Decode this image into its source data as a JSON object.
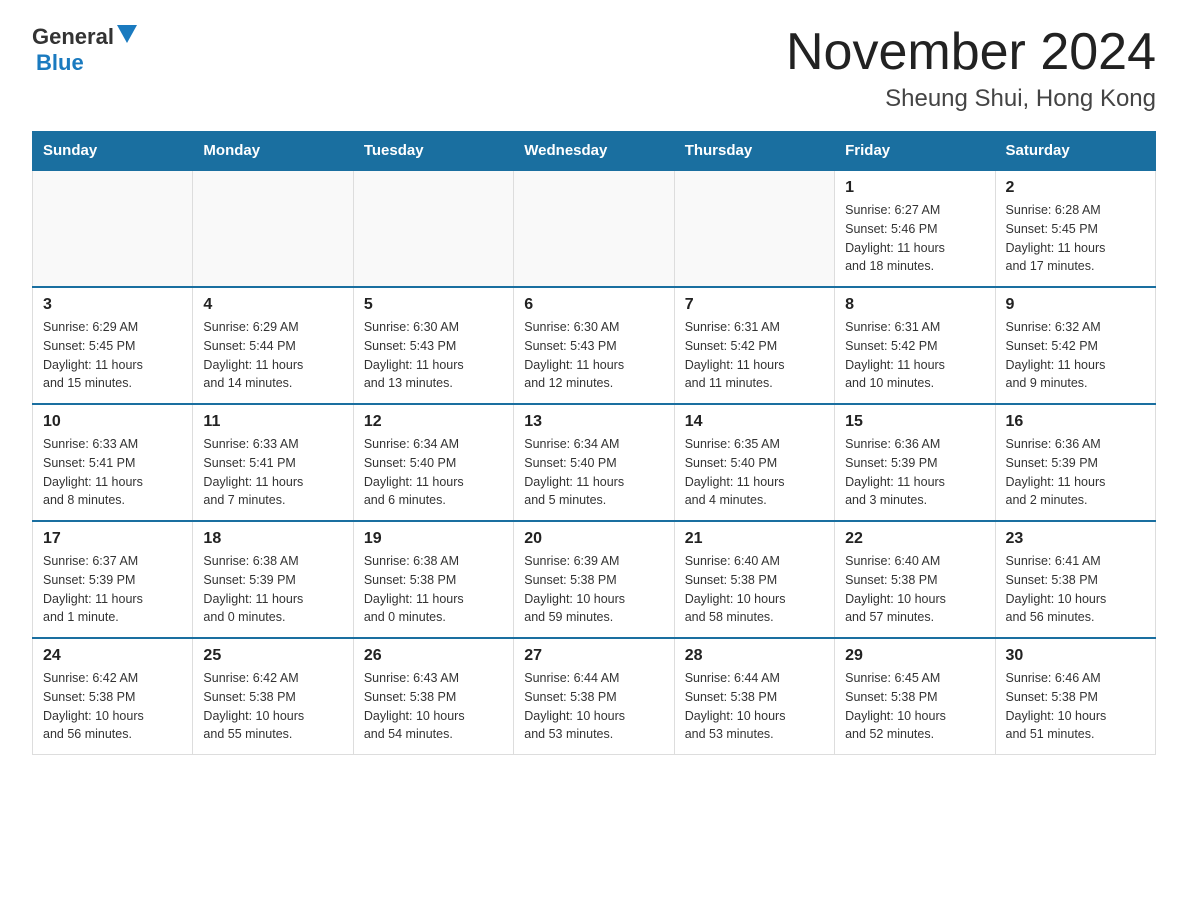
{
  "logo": {
    "general": "General",
    "triangle": "▲",
    "blue": "Blue"
  },
  "title": "November 2024",
  "subtitle": "Sheung Shui, Hong Kong",
  "days_header": [
    "Sunday",
    "Monday",
    "Tuesday",
    "Wednesday",
    "Thursday",
    "Friday",
    "Saturday"
  ],
  "weeks": [
    [
      {
        "day": "",
        "info": ""
      },
      {
        "day": "",
        "info": ""
      },
      {
        "day": "",
        "info": ""
      },
      {
        "day": "",
        "info": ""
      },
      {
        "day": "",
        "info": ""
      },
      {
        "day": "1",
        "info": "Sunrise: 6:27 AM\nSunset: 5:46 PM\nDaylight: 11 hours\nand 18 minutes."
      },
      {
        "day": "2",
        "info": "Sunrise: 6:28 AM\nSunset: 5:45 PM\nDaylight: 11 hours\nand 17 minutes."
      }
    ],
    [
      {
        "day": "3",
        "info": "Sunrise: 6:29 AM\nSunset: 5:45 PM\nDaylight: 11 hours\nand 15 minutes."
      },
      {
        "day": "4",
        "info": "Sunrise: 6:29 AM\nSunset: 5:44 PM\nDaylight: 11 hours\nand 14 minutes."
      },
      {
        "day": "5",
        "info": "Sunrise: 6:30 AM\nSunset: 5:43 PM\nDaylight: 11 hours\nand 13 minutes."
      },
      {
        "day": "6",
        "info": "Sunrise: 6:30 AM\nSunset: 5:43 PM\nDaylight: 11 hours\nand 12 minutes."
      },
      {
        "day": "7",
        "info": "Sunrise: 6:31 AM\nSunset: 5:42 PM\nDaylight: 11 hours\nand 11 minutes."
      },
      {
        "day": "8",
        "info": "Sunrise: 6:31 AM\nSunset: 5:42 PM\nDaylight: 11 hours\nand 10 minutes."
      },
      {
        "day": "9",
        "info": "Sunrise: 6:32 AM\nSunset: 5:42 PM\nDaylight: 11 hours\nand 9 minutes."
      }
    ],
    [
      {
        "day": "10",
        "info": "Sunrise: 6:33 AM\nSunset: 5:41 PM\nDaylight: 11 hours\nand 8 minutes."
      },
      {
        "day": "11",
        "info": "Sunrise: 6:33 AM\nSunset: 5:41 PM\nDaylight: 11 hours\nand 7 minutes."
      },
      {
        "day": "12",
        "info": "Sunrise: 6:34 AM\nSunset: 5:40 PM\nDaylight: 11 hours\nand 6 minutes."
      },
      {
        "day": "13",
        "info": "Sunrise: 6:34 AM\nSunset: 5:40 PM\nDaylight: 11 hours\nand 5 minutes."
      },
      {
        "day": "14",
        "info": "Sunrise: 6:35 AM\nSunset: 5:40 PM\nDaylight: 11 hours\nand 4 minutes."
      },
      {
        "day": "15",
        "info": "Sunrise: 6:36 AM\nSunset: 5:39 PM\nDaylight: 11 hours\nand 3 minutes."
      },
      {
        "day": "16",
        "info": "Sunrise: 6:36 AM\nSunset: 5:39 PM\nDaylight: 11 hours\nand 2 minutes."
      }
    ],
    [
      {
        "day": "17",
        "info": "Sunrise: 6:37 AM\nSunset: 5:39 PM\nDaylight: 11 hours\nand 1 minute."
      },
      {
        "day": "18",
        "info": "Sunrise: 6:38 AM\nSunset: 5:39 PM\nDaylight: 11 hours\nand 0 minutes."
      },
      {
        "day": "19",
        "info": "Sunrise: 6:38 AM\nSunset: 5:38 PM\nDaylight: 11 hours\nand 0 minutes."
      },
      {
        "day": "20",
        "info": "Sunrise: 6:39 AM\nSunset: 5:38 PM\nDaylight: 10 hours\nand 59 minutes."
      },
      {
        "day": "21",
        "info": "Sunrise: 6:40 AM\nSunset: 5:38 PM\nDaylight: 10 hours\nand 58 minutes."
      },
      {
        "day": "22",
        "info": "Sunrise: 6:40 AM\nSunset: 5:38 PM\nDaylight: 10 hours\nand 57 minutes."
      },
      {
        "day": "23",
        "info": "Sunrise: 6:41 AM\nSunset: 5:38 PM\nDaylight: 10 hours\nand 56 minutes."
      }
    ],
    [
      {
        "day": "24",
        "info": "Sunrise: 6:42 AM\nSunset: 5:38 PM\nDaylight: 10 hours\nand 56 minutes."
      },
      {
        "day": "25",
        "info": "Sunrise: 6:42 AM\nSunset: 5:38 PM\nDaylight: 10 hours\nand 55 minutes."
      },
      {
        "day": "26",
        "info": "Sunrise: 6:43 AM\nSunset: 5:38 PM\nDaylight: 10 hours\nand 54 minutes."
      },
      {
        "day": "27",
        "info": "Sunrise: 6:44 AM\nSunset: 5:38 PM\nDaylight: 10 hours\nand 53 minutes."
      },
      {
        "day": "28",
        "info": "Sunrise: 6:44 AM\nSunset: 5:38 PM\nDaylight: 10 hours\nand 53 minutes."
      },
      {
        "day": "29",
        "info": "Sunrise: 6:45 AM\nSunset: 5:38 PM\nDaylight: 10 hours\nand 52 minutes."
      },
      {
        "day": "30",
        "info": "Sunrise: 6:46 AM\nSunset: 5:38 PM\nDaylight: 10 hours\nand 51 minutes."
      }
    ]
  ]
}
